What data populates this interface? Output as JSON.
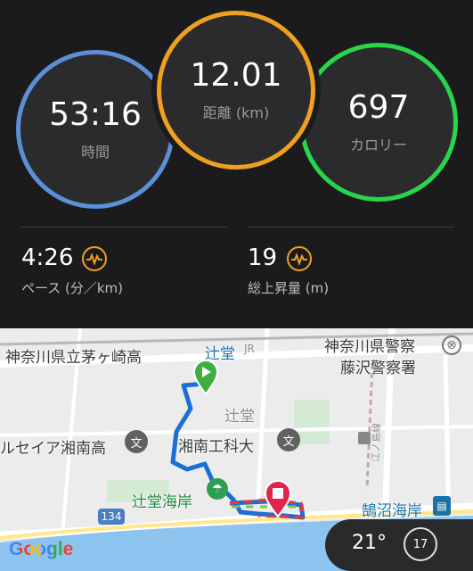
{
  "rings": {
    "time": {
      "value": "53:16",
      "label": "時間"
    },
    "distance": {
      "value": "12.01",
      "label": "距離 (km)"
    },
    "calories": {
      "value": "697",
      "label": "カロリー"
    }
  },
  "metrics": {
    "pace": {
      "value": "4:26",
      "label": "ペース (分／km)"
    },
    "elevation": {
      "value": "19",
      "label": "総上昇量 (m)"
    }
  },
  "map": {
    "labels": {
      "school1": "神奈川県立茅ヶ崎高",
      "station": "辻堂",
      "jr": "JR",
      "police1": "神奈川県警察",
      "police2": "藤沢警察署",
      "area": "辻堂",
      "school2": "ルセイア湘南高",
      "school3": "湘南工科大",
      "beach1": "辻堂海岸",
      "beach2": "鵠沼海岸",
      "road": "134",
      "line": "江ノ島線"
    },
    "provider": "Google"
  },
  "weather": {
    "temp": "21°",
    "wind": "17"
  },
  "colors": {
    "time_ring": "#5b8fd6",
    "distance_ring": "#f0a020",
    "calories_ring": "#27d64a",
    "accent": "#f0a020",
    "route": "#1a6fd6"
  }
}
